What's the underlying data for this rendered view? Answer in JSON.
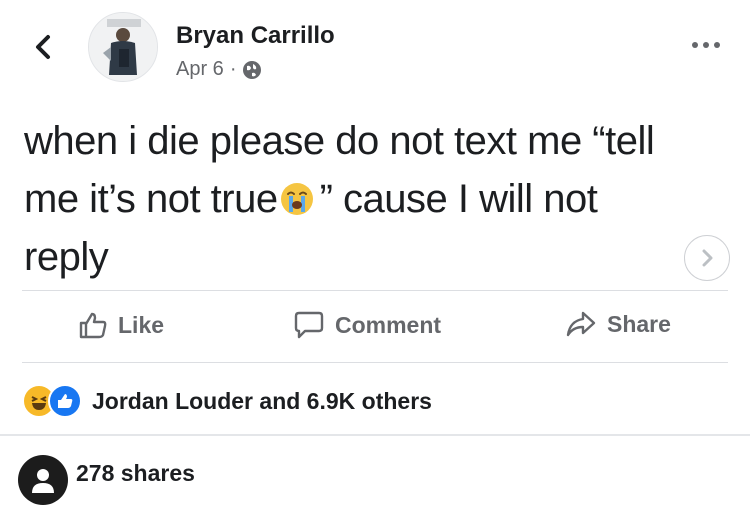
{
  "post": {
    "author": "Bryan Carrillo",
    "date": "Apr 6",
    "separator": "·",
    "text_line1": "when i die please do not text me “tell",
    "text_line2a": "me it’s not true",
    "text_line2b": "” cause I will not",
    "text_line3": "reply",
    "emoji_icon": "loudly-crying-face-icon"
  },
  "actions": {
    "like": "Like",
    "comment": "Comment",
    "share": "Share"
  },
  "reactions": {
    "icons": [
      "haha-reaction-icon",
      "like-reaction-icon"
    ],
    "summary": "Jordan Louder and 6.9K others"
  },
  "footer": {
    "shares": "278 shares"
  },
  "colors": {
    "text": "#1c1e21",
    "secondary": "#65676b",
    "like_blue": "#1877f2",
    "haha_yellow": "#f7b928"
  }
}
